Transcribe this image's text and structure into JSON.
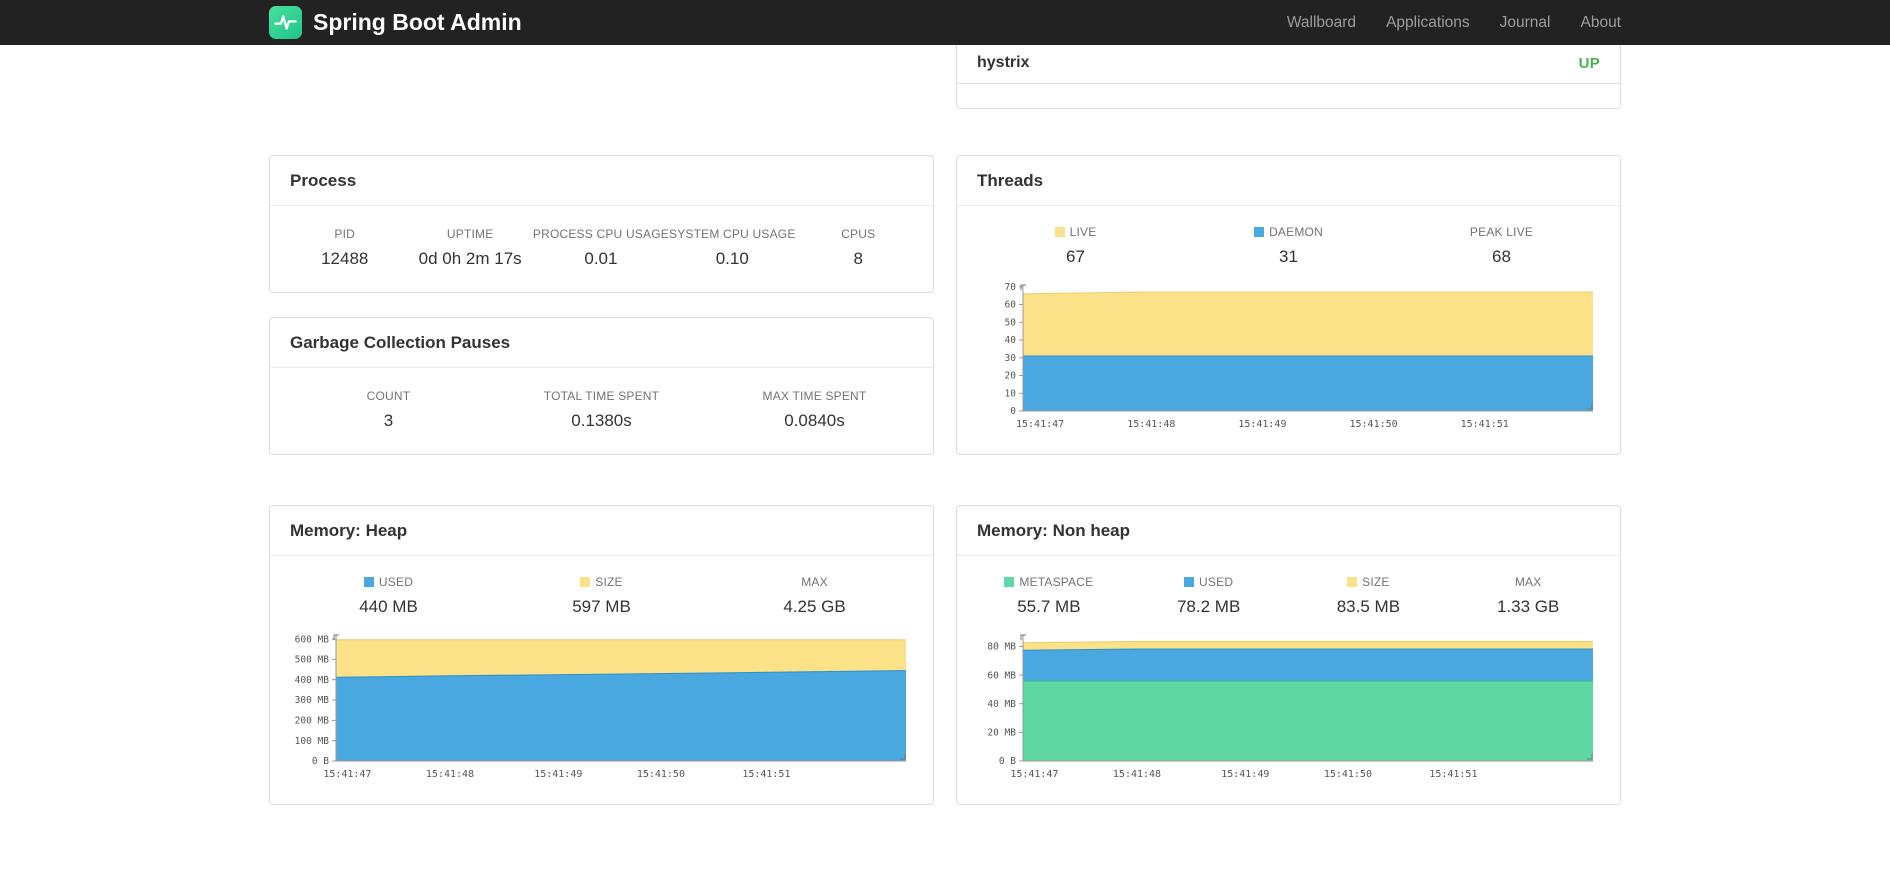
{
  "navbar": {
    "brand": "Spring Boot Admin",
    "items": [
      {
        "label": "Wallboard"
      },
      {
        "label": "Applications"
      },
      {
        "label": "Journal"
      },
      {
        "label": "About"
      }
    ]
  },
  "application_list": {
    "app_name": "hystrix",
    "status": "UP",
    "status_color": "#4caf50"
  },
  "panels": {
    "process": {
      "title": "Process",
      "metrics": [
        {
          "label": "PID",
          "value": "12488"
        },
        {
          "label": "UPTIME",
          "value": "0d 0h 2m 17s"
        },
        {
          "label": "PROCESS CPU USAGE",
          "value": "0.01"
        },
        {
          "label": "SYSTEM CPU USAGE",
          "value": "0.10"
        },
        {
          "label": "CPUS",
          "value": "8"
        }
      ]
    },
    "gc": {
      "title": "Garbage Collection Pauses",
      "metrics": [
        {
          "label": "COUNT",
          "value": "3"
        },
        {
          "label": "TOTAL TIME SPENT",
          "value": "0.1380s"
        },
        {
          "label": "MAX TIME SPENT",
          "value": "0.0840s"
        }
      ]
    },
    "threads": {
      "title": "Threads",
      "legend": [
        {
          "label": "LIVE",
          "value": "67",
          "color": "#fbe187"
        },
        {
          "label": "DAEMON",
          "value": "31",
          "color": "#4aa8e0"
        },
        {
          "label": "PEAK LIVE",
          "value": "68",
          "color": ""
        }
      ]
    },
    "heap": {
      "title": "Memory: Heap",
      "legend": [
        {
          "label": "USED",
          "value": "440 MB",
          "color": "#4aa8e0"
        },
        {
          "label": "SIZE",
          "value": "597 MB",
          "color": "#fbe187"
        },
        {
          "label": "MAX",
          "value": "4.25 GB",
          "color": ""
        }
      ]
    },
    "nonheap": {
      "title": "Memory: Non heap",
      "legend": [
        {
          "label": "METASPACE",
          "value": "55.7 MB",
          "color": "#5ed7a2"
        },
        {
          "label": "USED",
          "value": "78.2 MB",
          "color": "#4aa8e0"
        },
        {
          "label": "SIZE",
          "value": "83.5 MB",
          "color": "#fbe187"
        },
        {
          "label": "MAX",
          "value": "1.33 GB",
          "color": ""
        }
      ]
    }
  },
  "colors": {
    "up_green": "#4caf50",
    "series_yellow": "#fbe187",
    "series_blue": "#4aa8e0",
    "series_green": "#5ed7a2"
  },
  "chart_data": [
    {
      "id": "threads",
      "type": "area",
      "stacked": true,
      "title": "Threads over time",
      "y_max": 71,
      "y_ticks": [
        {
          "value": 0,
          "label": "0"
        },
        {
          "value": 10,
          "label": "10"
        },
        {
          "value": 20,
          "label": "20"
        },
        {
          "value": 30,
          "label": "30"
        },
        {
          "value": 40,
          "label": "40"
        },
        {
          "value": 50,
          "label": "50"
        },
        {
          "value": 60,
          "label": "60"
        },
        {
          "value": 70,
          "label": "70"
        }
      ],
      "x_labels": [
        {
          "label": "15:41:47",
          "pos": 0.03
        },
        {
          "label": "15:41:48",
          "pos": 0.225
        },
        {
          "label": "15:41:49",
          "pos": 0.42
        },
        {
          "label": "15:41:50",
          "pos": 0.615
        },
        {
          "label": "15:41:51",
          "pos": 0.81
        }
      ],
      "series": [
        {
          "name": "LIVE",
          "color": "#fbe187",
          "stroke": "#e9cf6b",
          "values": [
            66,
            67,
            67,
            67,
            67,
            67
          ]
        },
        {
          "name": "DAEMON",
          "color": "#4aa8e0",
          "stroke": "#2e8fc9",
          "values": [
            31,
            31,
            31,
            31,
            31,
            31
          ]
        }
      ]
    },
    {
      "id": "heap",
      "type": "area",
      "stacked": false,
      "title": "Heap memory over time (MB)",
      "y_max": 620,
      "y_ticks": [
        {
          "value": 0,
          "label": "0 B"
        },
        {
          "value": 100,
          "label": "100 MB"
        },
        {
          "value": 200,
          "label": "200 MB"
        },
        {
          "value": 300,
          "label": "300 MB"
        },
        {
          "value": 400,
          "label": "400 MB"
        },
        {
          "value": 500,
          "label": "500 MB"
        },
        {
          "value": 600,
          "label": "600 MB"
        }
      ],
      "x_labels": [
        {
          "label": "15:41:47",
          "pos": 0.02
        },
        {
          "label": "15:41:48",
          "pos": 0.2
        },
        {
          "label": "15:41:49",
          "pos": 0.39
        },
        {
          "label": "15:41:50",
          "pos": 0.57
        },
        {
          "label": "15:41:51",
          "pos": 0.755
        }
      ],
      "series": [
        {
          "name": "SIZE",
          "color": "#fbe187",
          "stroke": "#e9cf6b",
          "values": [
            597,
            597,
            597,
            597,
            597,
            597
          ]
        },
        {
          "name": "USED",
          "color": "#4aa8e0",
          "stroke": "#2e8fc9",
          "values": [
            412,
            419,
            425,
            431,
            438,
            445
          ]
        }
      ]
    },
    {
      "id": "nonheap",
      "type": "area",
      "stacked": false,
      "title": "Non heap memory over time (MB)",
      "y_max": 88,
      "y_ticks": [
        {
          "value": 0,
          "label": "0 B"
        },
        {
          "value": 20,
          "label": "20 MB"
        },
        {
          "value": 40,
          "label": "40 MB"
        },
        {
          "value": 60,
          "label": "60 MB"
        },
        {
          "value": 80,
          "label": "80 MB"
        }
      ],
      "x_labels": [
        {
          "label": "15:41:47",
          "pos": 0.02
        },
        {
          "label": "15:41:48",
          "pos": 0.2
        },
        {
          "label": "15:41:49",
          "pos": 0.39
        },
        {
          "label": "15:41:50",
          "pos": 0.57
        },
        {
          "label": "15:41:51",
          "pos": 0.755
        }
      ],
      "series": [
        {
          "name": "SIZE",
          "color": "#fbe187",
          "stroke": "#e9cf6b",
          "values": [
            82.6,
            83.5,
            83.5,
            83.5,
            83.5,
            83.5
          ]
        },
        {
          "name": "USED",
          "color": "#4aa8e0",
          "stroke": "#2e8fc9",
          "values": [
            77.3,
            78.2,
            78.2,
            78.2,
            78.2,
            78.2
          ]
        },
        {
          "name": "METASPACE",
          "color": "#5ed7a2",
          "stroke": "#3cc287",
          "values": [
            55.7,
            55.7,
            55.7,
            55.7,
            55.7,
            55.7
          ]
        }
      ]
    }
  ]
}
